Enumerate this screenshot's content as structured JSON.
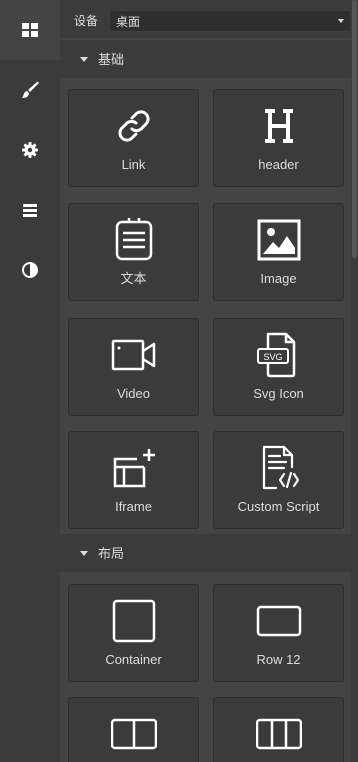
{
  "rail": {
    "items": [
      {
        "icon": "blocks-icon",
        "active": true
      },
      {
        "icon": "brush-icon",
        "active": false
      },
      {
        "icon": "gear-icon",
        "active": false
      },
      {
        "icon": "layers-icon",
        "active": false
      },
      {
        "icon": "contrast-icon",
        "active": false
      }
    ]
  },
  "device": {
    "label": "设备",
    "value": "桌面"
  },
  "categories": [
    {
      "title": "基础",
      "blocks": [
        {
          "label": "Link",
          "icon": "link-icon"
        },
        {
          "label": "header",
          "icon": "heading-icon"
        },
        {
          "label": "文本",
          "icon": "text-icon"
        },
        {
          "label": "Image",
          "icon": "image-icon"
        },
        {
          "label": "Video",
          "icon": "video-icon"
        },
        {
          "label": "Svg Icon",
          "icon": "svg-file-icon",
          "badge": "SVG"
        },
        {
          "label": "Iframe",
          "icon": "iframe-icon"
        },
        {
          "label": "Custom Script",
          "icon": "code-file-icon"
        }
      ]
    },
    {
      "title": "布局",
      "blocks": [
        {
          "label": "Container",
          "icon": "container-icon"
        },
        {
          "label": "Row 12",
          "icon": "row-icon"
        },
        {
          "label": "",
          "icon": "two-columns-icon"
        },
        {
          "label": "",
          "icon": "three-columns-icon"
        }
      ]
    }
  ],
  "colors": {
    "background": "#444444",
    "rail": "#3b3b3b",
    "text": "#dddddd"
  }
}
